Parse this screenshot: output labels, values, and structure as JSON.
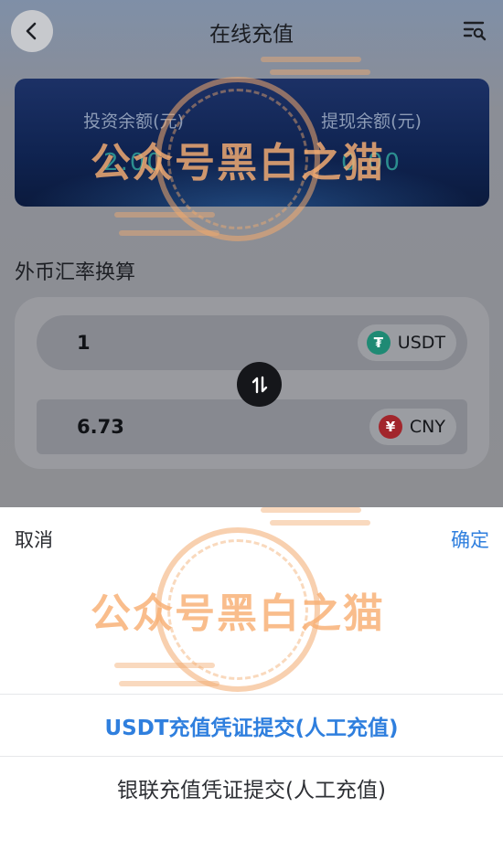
{
  "header": {
    "title": "在线充值",
    "back_icon": "chevron-left-icon",
    "records_icon": "list-search-icon"
  },
  "balance": {
    "invest_label": "投资余额(元)",
    "invest_value": "2.00",
    "withdraw_label": "提现余额(元)",
    "withdraw_value": "0.00"
  },
  "converter": {
    "section_title": "外币汇率换算",
    "from_amount": "1",
    "from_currency": "USDT",
    "from_icon_glyph": "₮",
    "to_amount": "6.73",
    "to_currency": "CNY",
    "to_icon_glyph": "¥",
    "swap_icon": "swap-vertical-icon"
  },
  "sheet": {
    "cancel_label": "取消",
    "confirm_label": "确定",
    "options": [
      {
        "label": "USDT充值凭证提交(人工充值)",
        "selected": true
      },
      {
        "label": "银联充值凭证提交(人工充值)",
        "selected": false
      }
    ]
  },
  "watermark": {
    "text": "公众号黑白之猫"
  },
  "colors": {
    "accent": "#2f7fde",
    "usdt": "#1f8a74",
    "cny": "#a2262c"
  }
}
